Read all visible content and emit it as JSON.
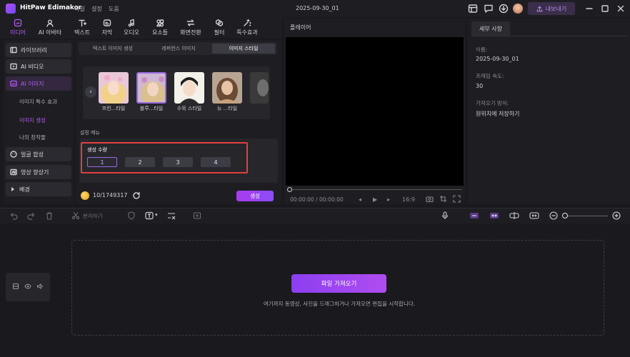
{
  "app": {
    "name": "HitPaw Edimakor",
    "menu": [
      "파일",
      "설정",
      "도움"
    ]
  },
  "project_title": "2025-09-30_01",
  "export_label": "내보내기",
  "toolbar": {
    "tabs": [
      {
        "label": "미디어",
        "icon": "media-icon",
        "active": true
      },
      {
        "label": "AI 아바타",
        "icon": "ai-avatar-icon"
      },
      {
        "label": "텍스트",
        "icon": "text-icon"
      },
      {
        "label": "자막",
        "icon": "subtitle-icon"
      },
      {
        "label": "오디오",
        "icon": "audio-icon"
      },
      {
        "label": "요소들",
        "icon": "elements-icon"
      },
      {
        "label": "화면전환",
        "icon": "transition-icon"
      },
      {
        "label": "필터",
        "icon": "filter-icon"
      },
      {
        "label": "특수효과",
        "icon": "effects-icon"
      }
    ]
  },
  "sidebar": {
    "items": [
      {
        "label": "라이브러리",
        "icon": "library-icon"
      },
      {
        "label": "AI 비디오",
        "icon": "ai-video-icon"
      },
      {
        "label": "AI 이미지",
        "icon": "ai-image-icon",
        "active": true
      },
      {
        "label": "얼굴 합성",
        "icon": "face-swap-icon"
      },
      {
        "label": "영상 향상기",
        "icon": "video-enhancer-icon"
      },
      {
        "label": "배경",
        "icon": "triangle-right-icon"
      }
    ],
    "sub_items": [
      {
        "label": "이미지 특수 효과"
      },
      {
        "label": "이미지 생성",
        "active": true
      },
      {
        "label": "나의 창작물"
      }
    ]
  },
  "ai_image": {
    "tabs": [
      "텍스트 이미지 생성",
      "레퍼런스 이미지",
      "이미지 스타일"
    ],
    "active_tab": 2,
    "styles": [
      {
        "label": "프린...타일"
      },
      {
        "label": "블루...타일"
      },
      {
        "label": "수묵 스타일"
      },
      {
        "label": "뉴 ...타일"
      }
    ],
    "settings_heading": "설정 메뉴",
    "count_label": "생성 수량",
    "counts": [
      "1",
      "2",
      "3",
      "4"
    ],
    "selected_count": "1",
    "credits": "10/1749317",
    "generate_label": "생성"
  },
  "player": {
    "label": "플레이어",
    "timecode": "00:00:00 / 00:00:00",
    "ratio": "16:9"
  },
  "details": {
    "tab": "세부 사항",
    "fields": [
      {
        "label": "이름:",
        "value": "2025-09-30_01"
      },
      {
        "label": "프레임 속도:",
        "value": "30"
      },
      {
        "label": "가져오기 방식:",
        "value": "원위치에 저장하기"
      }
    ]
  },
  "timeline": {
    "split_label": "분리하기",
    "import_label": "파일 가져오기",
    "drop_hint": "여기까지 동영상, 사진을 드래그하거나 가져오면 편집을 시작합니다."
  }
}
